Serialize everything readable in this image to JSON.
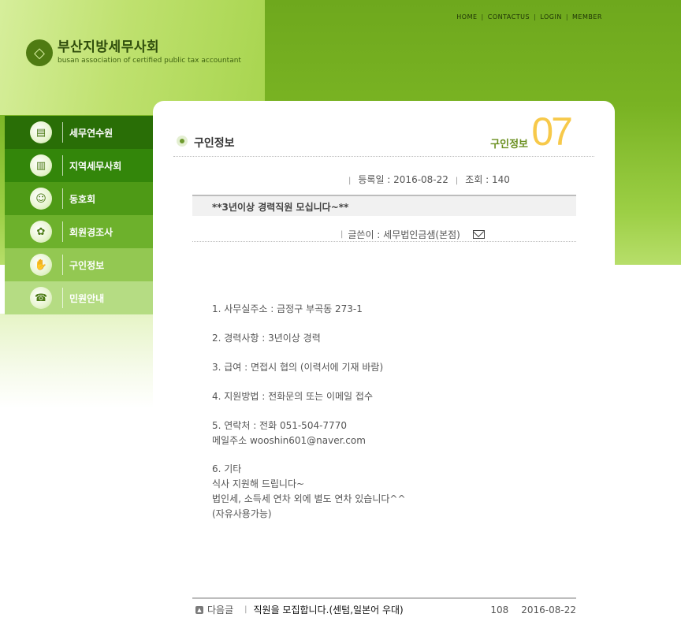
{
  "header": {
    "logo_kr": "부산지방세무사회",
    "logo_en": "busan association of certified public tax accountant",
    "nav": [
      "HOME",
      "CONTACTUS",
      "LOGIN",
      "MEMBER"
    ]
  },
  "sidebar": {
    "items": [
      {
        "label": "세무연수원",
        "bg": "#296e06"
      },
      {
        "label": "지역세무사회",
        "bg": "#33860a"
      },
      {
        "label": "동호회",
        "bg": "#4e9a16"
      },
      {
        "label": "회원경조사",
        "bg": "#6db12c"
      },
      {
        "label": "구인정보",
        "bg": "#93c852"
      },
      {
        "label": "민원안내",
        "bg": "#b5dc83"
      }
    ]
  },
  "page": {
    "title": "구인정보",
    "section_title": "구인정보",
    "section_num": "07"
  },
  "post": {
    "date_label": "등록일 : 2016-08-22",
    "views_label": "조회 : 140",
    "title": "**3년이상 경력직원 모십니다~**",
    "writer_label": "글쓴이 : 세무법인금샘(본점)",
    "body": [
      "1. 사무실주소 : 금정구 부곡동 273-1",
      "2. 경력사항 : 3년이상 경력",
      "3. 급여 : 면접시 협의 (이력서에 기재 바람)",
      "4. 지원방법 : 전화문의 또는 이메일 접수",
      "5. 연락처 : 전화 051-504-7770",
      "메일주소 wooshin601@naver.com",
      "6. 기타",
      "식사 지원해 드립니다~",
      "법인세, 소득세 연차 외에 별도 연차 있습니다^^",
      "(자유사용가능)"
    ]
  },
  "next_post": {
    "label": "다음글",
    "title": "직원을 모집합니다.(센텀,일본어 우대)",
    "views": "108",
    "date": "2016-08-22"
  },
  "colors": {
    "brand_green": "#6ea81d",
    "accent_orange": "#f7c94a"
  }
}
